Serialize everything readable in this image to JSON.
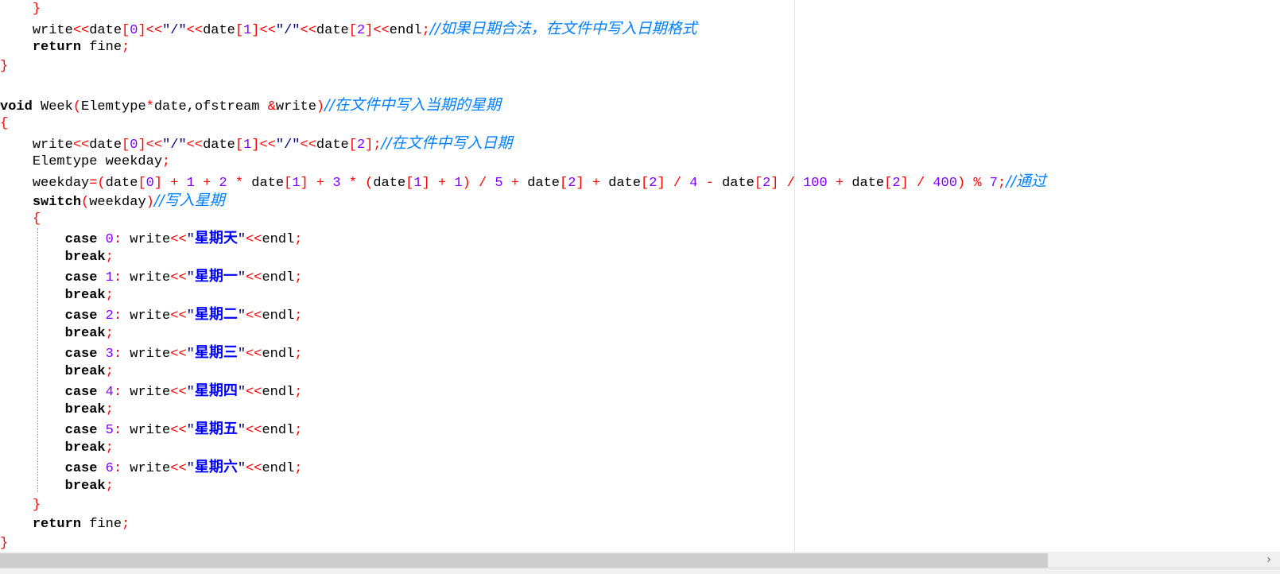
{
  "code": {
    "l1": {
      "brace": "}"
    },
    "l2": {
      "write": "write",
      "op1": "<<",
      "date1": "date",
      "b1": "[",
      "n1": "0",
      "b2": "]",
      "op2": "<<",
      "q1": "\"/\"",
      "op3": "<<",
      "date2": "date",
      "b3": "[",
      "n2": "1",
      "b4": "]",
      "op4": "<<",
      "q2": "\"/\"",
      "op5": "<<",
      "date3": "date",
      "b5": "[",
      "n3": "2",
      "b6": "]",
      "op6": "<<",
      "endl": "endl",
      "semi": ";",
      "comment": "//如果日期合法，在文件中写入日期格式"
    },
    "l3": {
      "kw": "return",
      "rest": " fine",
      "semi": ";"
    },
    "l4": {
      "brace": "}"
    },
    "l5": {
      "kw": "void",
      "name": " Week",
      "p1": "(",
      "type": "Elemtype",
      "star": "*",
      "args": "date,ofstream ",
      "amp": "&",
      "arg2": "write",
      "p2": ")",
      "comment": "//在文件中写入当期的星期"
    },
    "l6": {
      "brace": "{"
    },
    "l7": {
      "write": "write",
      "op1": "<<",
      "date1": "date",
      "b1": "[",
      "n1": "0",
      "b2": "]",
      "op2": "<<",
      "q1": "\"/\"",
      "op3": "<<",
      "date2": "date",
      "b3": "[",
      "n2": "1",
      "b4": "]",
      "op4": "<<",
      "q2": "\"/\"",
      "op5": "<<",
      "date3": "date",
      "b5": "[",
      "n3": "2",
      "b6": "]",
      "semi": ";",
      "comment": "//在文件中写入日期"
    },
    "l8": {
      "text": "Elemtype weekday",
      "semi": ";"
    },
    "l9": {
      "var": "weekday",
      "eq": "=(",
      "t1": "date",
      "b1": "[",
      "n0": "0",
      "b2": "]",
      "plus1": " + ",
      "one1": "1",
      "plus2": " + ",
      "two1": "2",
      "mul1": " * ",
      "t2": "date",
      "b3": "[",
      "n1": "1",
      "b4": "]",
      "plus3": " + ",
      "mul2": "3",
      "mul3": " * ",
      "paren1": "(",
      "t3": "date",
      "b5": "[",
      "n2": "1",
      "b6": "]",
      "plus4": " + ",
      "one2": "1",
      "paren2": ")",
      "div1": " / ",
      "five": "5",
      "plus5": " + ",
      "t4": "date",
      "b7": "[",
      "n3": "2",
      "b8": "]",
      "plus6": " + ",
      "t5": "date",
      "b9": "[",
      "n4": "2",
      "b10": "]",
      "div2": " / ",
      "four": "4",
      "minus": " - ",
      "t6": "date",
      "b11": "[",
      "n5": "2",
      "b12": "]",
      "div3": " / ",
      "hundred": "100",
      "plus7": " + ",
      "t7": "date",
      "b13": "[",
      "n6": "2",
      "b14": "]",
      "div4": " / ",
      "fourhundred": "400",
      "paren3": ")",
      "mod": " % ",
      "seven": "7",
      "semi": ";",
      "comment": "//通过"
    },
    "l10": {
      "kw": "switch",
      "p1": "(",
      "var": "weekday",
      "p2": ")",
      "comment": "//写入星期"
    },
    "l11": {
      "brace": "{"
    },
    "cases": [
      {
        "kw": "case",
        "num": "0",
        "colon": ": ",
        "write": "write",
        "op1": "<<",
        "q1": "\"",
        "str": "星期天",
        "q2": "\"",
        "op2": "<<",
        "endl": "endl",
        "semi": ";",
        "brk": "break",
        "bsemi": ";"
      },
      {
        "kw": "case",
        "num": "1",
        "colon": ": ",
        "write": "write",
        "op1": "<<",
        "q1": "\"",
        "str": "星期一",
        "q2": "\"",
        "op2": "<<",
        "endl": "endl",
        "semi": ";",
        "brk": "break",
        "bsemi": ";"
      },
      {
        "kw": "case",
        "num": "2",
        "colon": ": ",
        "write": "write",
        "op1": "<<",
        "q1": "\"",
        "str": "星期二",
        "q2": "\"",
        "op2": "<<",
        "endl": "endl",
        "semi": ";",
        "brk": "break",
        "bsemi": ";"
      },
      {
        "kw": "case",
        "num": "3",
        "colon": ": ",
        "write": "write",
        "op1": "<<",
        "q1": "\"",
        "str": "星期三",
        "q2": "\"",
        "op2": "<<",
        "endl": "endl",
        "semi": ";",
        "brk": "break",
        "bsemi": ";"
      },
      {
        "kw": "case",
        "num": "4",
        "colon": ": ",
        "write": "write",
        "op1": "<<",
        "q1": "\"",
        "str": "星期四",
        "q2": "\"",
        "op2": "<<",
        "endl": "endl",
        "semi": ";",
        "brk": "break",
        "bsemi": ";"
      },
      {
        "kw": "case",
        "num": "5",
        "colon": ": ",
        "write": "write",
        "op1": "<<",
        "q1": "\"",
        "str": "星期五",
        "q2": "\"",
        "op2": "<<",
        "endl": "endl",
        "semi": ";",
        "brk": "break",
        "bsemi": ";"
      },
      {
        "kw": "case",
        "num": "6",
        "colon": ": ",
        "write": "write",
        "op1": "<<",
        "q1": "\"",
        "str": "星期六",
        "q2": "\"",
        "op2": "<<",
        "endl": "endl",
        "semi": ";",
        "brk": "break",
        "bsemi": ";"
      }
    ],
    "l26": {
      "brace": "}"
    },
    "l27": {
      "kw": "return",
      "rest": " fine",
      "semi": ";"
    },
    "l28": {
      "brace": "}"
    }
  },
  "scrollbar": {
    "right_arrow": "›"
  },
  "colors": {
    "keyword": "#000000",
    "operator": "#ff0000",
    "string": "#000080",
    "number": "#8000ff",
    "comment": "#0080ff",
    "chinese_string": "#0000ff"
  }
}
